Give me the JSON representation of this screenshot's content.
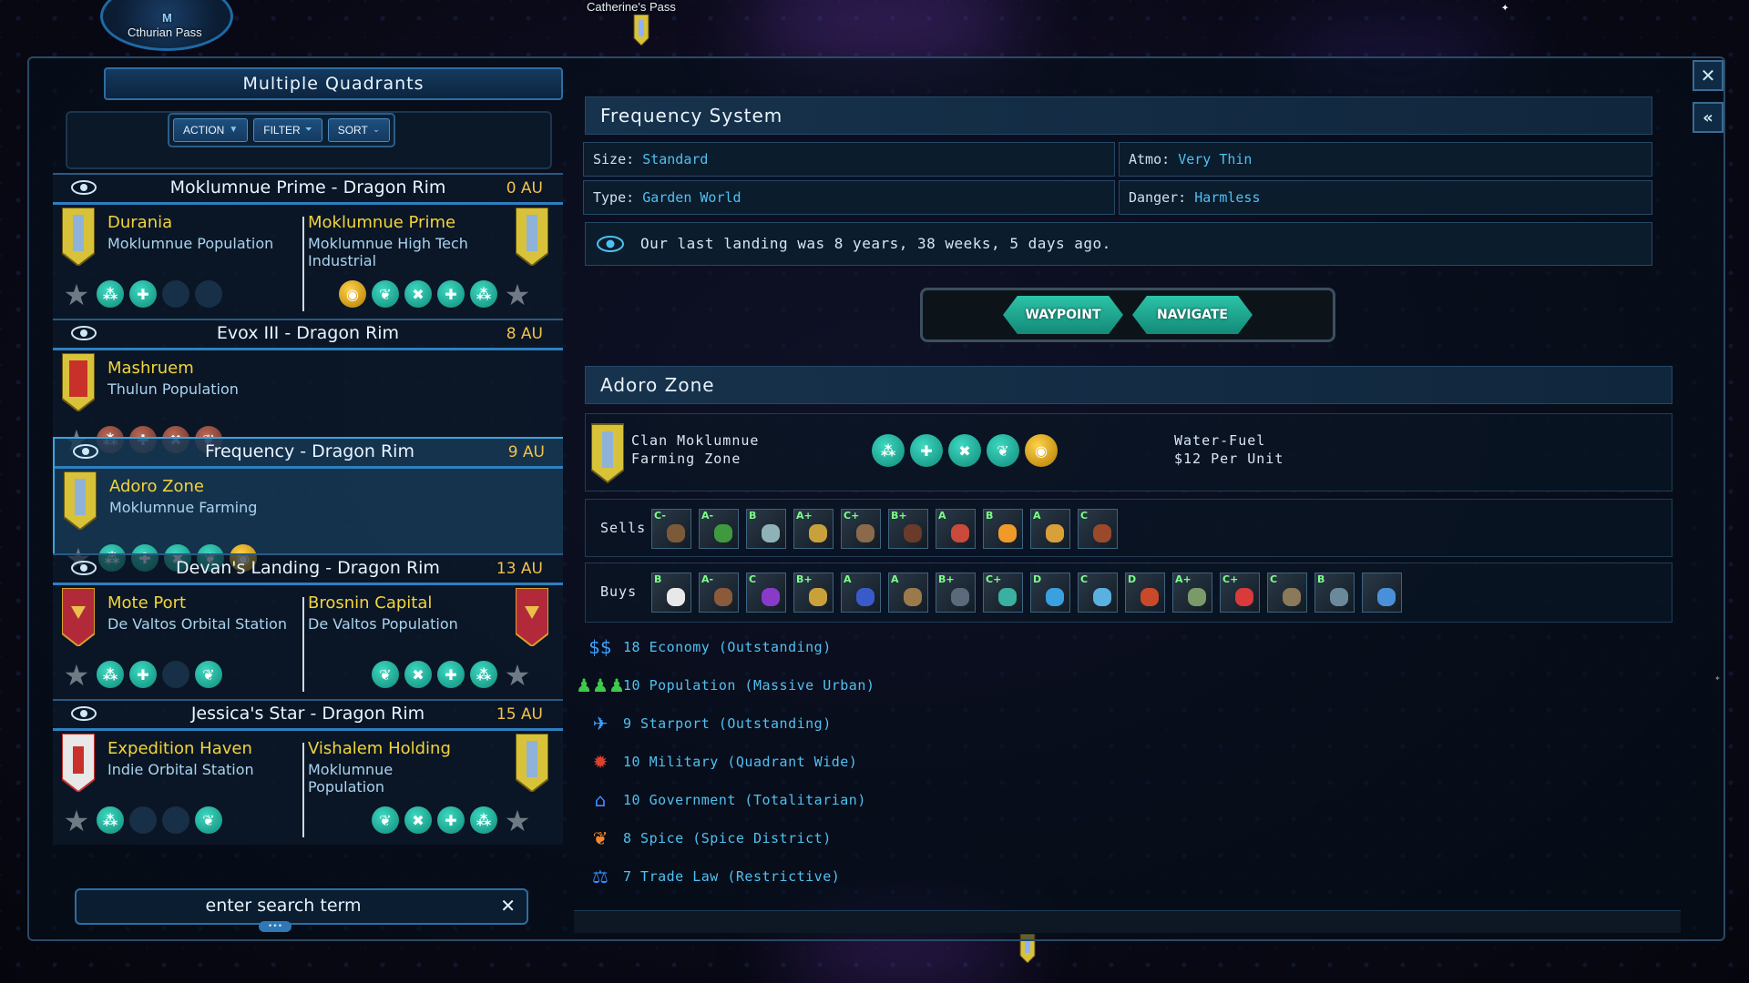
{
  "top_markers": {
    "left": {
      "letter": "M",
      "label": "Cthurian Pass"
    },
    "center": {
      "label": "Catherine's Pass"
    }
  },
  "left_panel": {
    "title": "Multiple Quadrants",
    "toolbar": {
      "action": "ACTION",
      "filter": "FILTER",
      "sort": "SORT"
    },
    "systems": [
      {
        "name": "Moklumnue Prime - Dragon Rim",
        "distance": "0 AU",
        "selected": false,
        "zones": [
          {
            "name": "Durania",
            "sub": "Moklumnue Population",
            "banner": "gold",
            "icons": [
              "teal",
              "teal",
              "empty",
              "empty"
            ]
          },
          {
            "name": "Moklumnue Prime",
            "sub": "Moklumnue High Tech Industrial",
            "banner": "gold",
            "icons": [
              "gold",
              "teal",
              "teal",
              "teal",
              "teal"
            ]
          }
        ]
      },
      {
        "name": "Evox III - Dragon Rim",
        "distance": "8 AU",
        "selected": false,
        "zones": [
          {
            "name": "Mashruem",
            "sub": "Thulun Population",
            "banner": "red-gold",
            "icons": [
              "red",
              "red",
              "red",
              "red"
            ]
          }
        ]
      },
      {
        "name": "Frequency - Dragon Rim",
        "distance": "9 AU",
        "selected": true,
        "zones": [
          {
            "name": "Adoro Zone",
            "sub": "Moklumnue Farming",
            "banner": "gold",
            "icons": [
              "teal",
              "teal",
              "teal",
              "teal",
              "gold"
            ]
          }
        ]
      },
      {
        "name": "Devan's Landing - Dragon Rim",
        "distance": "13 AU",
        "selected": false,
        "zones": [
          {
            "name": "Mote Port",
            "sub": "De Valtos Orbital Station",
            "banner": "crimson",
            "icons": [
              "teal",
              "teal",
              "empty",
              "teal"
            ]
          },
          {
            "name": "Brosnin Capital",
            "sub": "De Valtos Population",
            "banner": "crimson",
            "icons": [
              "teal",
              "teal",
              "teal",
              "teal"
            ]
          }
        ]
      },
      {
        "name": "Jessica's Star - Dragon Rim",
        "distance": "15 AU",
        "selected": false,
        "zones": [
          {
            "name": "Expedition Haven",
            "sub": "Indie Orbital Station",
            "banner": "white-red",
            "icons": [
              "teal",
              "empty",
              "empty",
              "teal"
            ]
          },
          {
            "name": "Vishalem Holding",
            "sub": "Moklumnue Population",
            "banner": "gold",
            "icons": [
              "teal",
              "teal",
              "teal",
              "teal"
            ]
          }
        ]
      }
    ],
    "search_placeholder": "enter search term"
  },
  "detail": {
    "system_title": "Frequency System",
    "size": {
      "label": "Size:",
      "value": "Standard"
    },
    "atmo": {
      "label": "Atmo:",
      "value": "Very Thin"
    },
    "type": {
      "label": "Type:",
      "value": "Garden World"
    },
    "danger": {
      "label": "Danger:",
      "value": "Harmless"
    },
    "last_landing": "Our last landing was 8 years, 38 weeks, 5 days ago.",
    "waypoint": "WAYPOINT",
    "navigate": "NAVIGATE",
    "zone_title": "Adoro Zone",
    "zone_owner_line1": "Clan Moklumnue",
    "zone_owner_line2": "Farming Zone",
    "zone_icons": [
      "teal",
      "teal",
      "teal",
      "teal",
      "gold"
    ],
    "fuel_line1": "Water-Fuel",
    "fuel_line2": "$12 Per Unit",
    "sells_label": "Sells",
    "sells": [
      {
        "grade": "C-",
        "color": "#7b5a3a"
      },
      {
        "grade": "A-",
        "color": "#3f9a3f"
      },
      {
        "grade": "B",
        "color": "#8fb2b8"
      },
      {
        "grade": "A+",
        "color": "#c9a13a"
      },
      {
        "grade": "C+",
        "color": "#8a6a4a"
      },
      {
        "grade": "B+",
        "color": "#6a3a2a"
      },
      {
        "grade": "A",
        "color": "#c94a3a"
      },
      {
        "grade": "B",
        "color": "#f09a2a"
      },
      {
        "grade": "A",
        "color": "#d9a03a"
      },
      {
        "grade": "C",
        "color": "#9a4a2a"
      }
    ],
    "buys_label": "Buys",
    "buys": [
      {
        "grade": "B",
        "color": "#e8e8e8"
      },
      {
        "grade": "A-",
        "color": "#8a5a3a"
      },
      {
        "grade": "C",
        "color": "#8a3ac9"
      },
      {
        "grade": "B+",
        "color": "#c9a13a"
      },
      {
        "grade": "A",
        "color": "#3a5ac9"
      },
      {
        "grade": "A",
        "color": "#9a7a4a"
      },
      {
        "grade": "B+",
        "color": "#5a6a7a"
      },
      {
        "grade": "C+",
        "color": "#3ab0a0"
      },
      {
        "grade": "D",
        "color": "#3aa0e0"
      },
      {
        "grade": "C",
        "color": "#5ab0e0"
      },
      {
        "grade": "D",
        "color": "#c94a2a"
      },
      {
        "grade": "A+",
        "color": "#7a9a6a"
      },
      {
        "grade": "C+",
        "color": "#d93a3a"
      },
      {
        "grade": "C",
        "color": "#8a7a5a"
      },
      {
        "grade": "B",
        "color": "#6a8a9a"
      },
      {
        "grade": "",
        "color": "#4a90d9"
      }
    ],
    "stats": [
      {
        "icon": "economy-icon",
        "symbol": "$$",
        "color": "#3aa0ff",
        "text": "18 Economy (Outstanding)"
      },
      {
        "icon": "population-icon",
        "symbol": "♟♟♟",
        "color": "#3fc94a",
        "text": "10 Population (Massive Urban)"
      },
      {
        "icon": "starport-icon",
        "symbol": "✈",
        "color": "#3aa0ff",
        "text": "9 Starport (Outstanding)"
      },
      {
        "icon": "military-icon",
        "symbol": "✹",
        "color": "#e0402a",
        "text": "10 Military (Quadrant Wide)"
      },
      {
        "icon": "government-icon",
        "symbol": "⌂",
        "color": "#4a8aff",
        "text": "10 Government (Totalitarian)"
      },
      {
        "icon": "spice-icon",
        "symbol": "❦",
        "color": "#f08a2a",
        "text": "8 Spice (Spice District)"
      },
      {
        "icon": "trade-law-icon",
        "symbol": "⚖",
        "color": "#3a8aff",
        "text": "7 Trade Law (Restrictive)"
      }
    ]
  }
}
